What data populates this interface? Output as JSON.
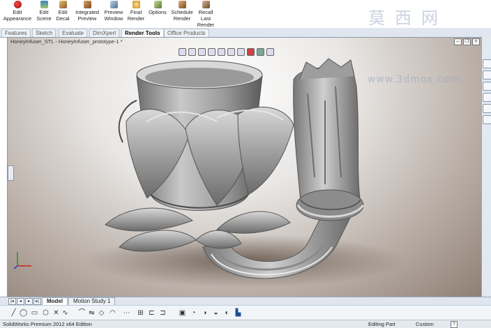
{
  "ribbon": {
    "buttons": [
      {
        "label": "Edit\nAppearance",
        "icon": "appearance-icon",
        "color": "#d03a2f"
      },
      {
        "label": "Edit\nScene",
        "icon": "scene-icon",
        "color": "#3f7fc2"
      },
      {
        "label": "Edit\nDecal",
        "icon": "decal-icon",
        "color": "#c28d3f"
      },
      {
        "label": "Integrated\nPreview",
        "icon": "integrated-preview-icon",
        "color": "#b07a3a"
      },
      {
        "label": "Preview\nWindow",
        "icon": "preview-window-icon",
        "color": "#6b8fb5"
      },
      {
        "label": "Final\nRender",
        "icon": "final-render-icon",
        "color": "#d4a23a"
      },
      {
        "label": "Options",
        "icon": "options-icon",
        "color": "#7a9a4a"
      },
      {
        "label": "Schedule\nRender",
        "icon": "schedule-render-icon",
        "color": "#a06a3a"
      },
      {
        "label": "Recall\nLast\nRender",
        "icon": "recall-render-icon",
        "color": "#8a6a4a"
      }
    ]
  },
  "watermark": {
    "chars": "莫西网",
    "url": "www.3dmox.com"
  },
  "tabs": [
    {
      "label": "Features"
    },
    {
      "label": "Sketch"
    },
    {
      "label": "Evaluate"
    },
    {
      "label": "DimXpert"
    },
    {
      "label": "Render Tools",
      "active": true
    },
    {
      "label": "Office Products"
    }
  ],
  "document": {
    "title": "HoneyInfuser_STL - HoneyInfuser_prototype-1 *"
  },
  "bottom_tabs": [
    {
      "label": "Model",
      "active": true
    },
    {
      "label": "Motion Study 1"
    }
  ],
  "status": {
    "app": "SolidWorks Premium 2012 x64 Edition",
    "mode": "Editing Part",
    "units": "Custom",
    "help": "?"
  },
  "colors": {
    "accent": "#1e4f91",
    "viewport_bg": "#b9aea6",
    "model": "#a8a8a8"
  }
}
